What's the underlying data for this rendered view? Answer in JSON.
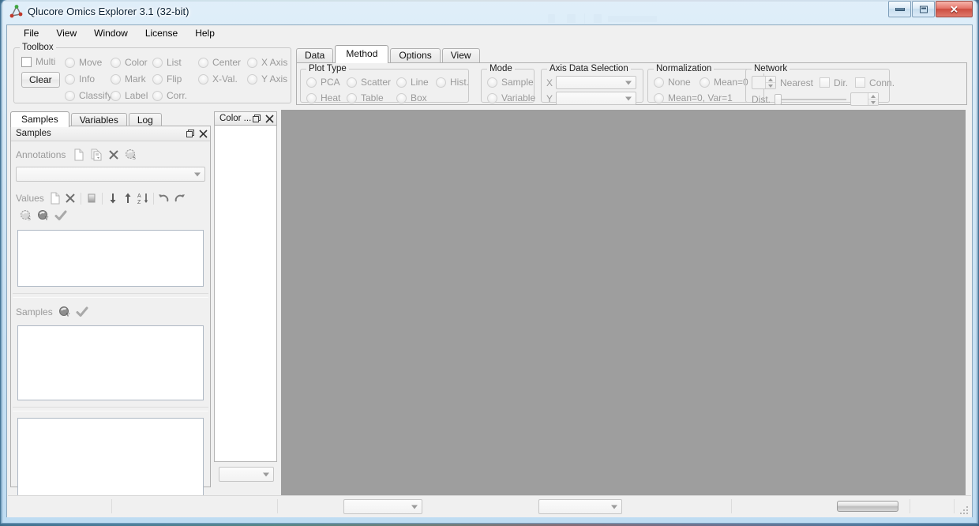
{
  "window": {
    "title": "Qlucore Omics Explorer 3.1 (32-bit)",
    "app_icon": "qlucore-triangle-icon",
    "controls": {
      "minimize": "minimize-icon",
      "maximize": "maximize-icon",
      "close": "close-icon"
    }
  },
  "menubar": {
    "items": [
      "File",
      "View",
      "Window",
      "License",
      "Help"
    ]
  },
  "toolbox": {
    "caption": "Toolbox",
    "multi_label": "Multi",
    "clear_label": "Clear",
    "items": [
      "Move",
      "Color",
      "List",
      "Center",
      "X Axis",
      "Info",
      "Mark",
      "Flip",
      "X-Val.",
      "Y Axis",
      "Classify",
      "Label",
      "Corr."
    ]
  },
  "tabs": {
    "items": [
      "Data",
      "Method",
      "Options",
      "View"
    ],
    "active": "Method"
  },
  "method": {
    "plot_type": {
      "caption": "Plot Type",
      "options": [
        "PCA",
        "Scatter",
        "Line",
        "Hist.",
        "Heat",
        "Table",
        "Box"
      ],
      "selected": ""
    },
    "mode": {
      "caption": "Mode",
      "options": [
        "Sample",
        "Variable"
      ],
      "selected": ""
    },
    "axis_data_selection": {
      "caption": "Axis Data Selection",
      "x_label": "X",
      "y_label": "Y",
      "x_value": "",
      "y_value": ""
    },
    "normalization": {
      "caption": "Normalization",
      "options": [
        "None",
        "Mean=0",
        "Mean=0, Var=1"
      ],
      "selected": ""
    },
    "network": {
      "caption": "Network",
      "nearest_value": "",
      "nearest_label": "Nearest",
      "dir_label": "Dir.",
      "conn_label": "Conn.",
      "dist_label": "Dist.",
      "dist_value": ""
    }
  },
  "dock_tabs": {
    "items": [
      "Samples",
      "Variables",
      "Log"
    ],
    "active": "Samples"
  },
  "samples_panel": {
    "title": "Samples",
    "float_icon": "restore-icon",
    "close_icon": "close-icon",
    "annotations_label": "Annotations",
    "annotations_icons": [
      "new-document-icon",
      "copy-document-icon",
      "delete-x-icon",
      "sphere-s-icon"
    ],
    "annotations_combo_value": "",
    "values_label": "Values",
    "values_icons": [
      "new-document-icon",
      "delete-x-icon",
      "gradient-swatch-icon",
      "arrow-down-icon",
      "arrow-up-icon",
      "sort-az-icon",
      "undo-icon",
      "redo-icon"
    ],
    "values_icons_row2": [
      "sphere-s-icon",
      "sphere-v-icon",
      "check-icon"
    ],
    "values_list": [],
    "samples_section_label": "Samples",
    "samples_section_icons": [
      "sphere-v-icon",
      "check-icon"
    ],
    "samples_list": [],
    "bottom_list": []
  },
  "color_panel": {
    "title": "Color ...",
    "float_icon": "restore-icon",
    "close_icon": "close-icon",
    "items": [],
    "combo_value": ""
  },
  "canvas": {
    "background": "#9e9e9e",
    "content": ""
  },
  "statusbar": {
    "left_combo_value": "",
    "mid_combo_value": "",
    "progress_value": "",
    "grip_icon": "resize-grip-icon"
  }
}
